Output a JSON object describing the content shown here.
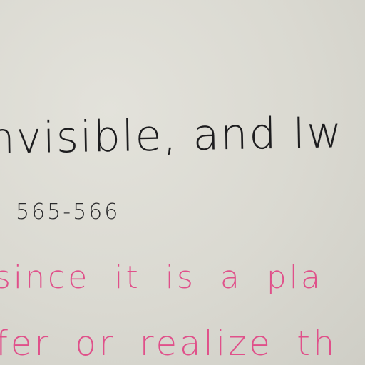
{
  "handwriting": {
    "line1": "nvisible, and Iw",
    "line2": "565-566",
    "line3": "since it is a pla",
    "line4": "fer or realize th"
  },
  "colors": {
    "paper": "#dad9d1",
    "black_ink": "#1d1d1f",
    "pink_ink": "#e0508a"
  }
}
